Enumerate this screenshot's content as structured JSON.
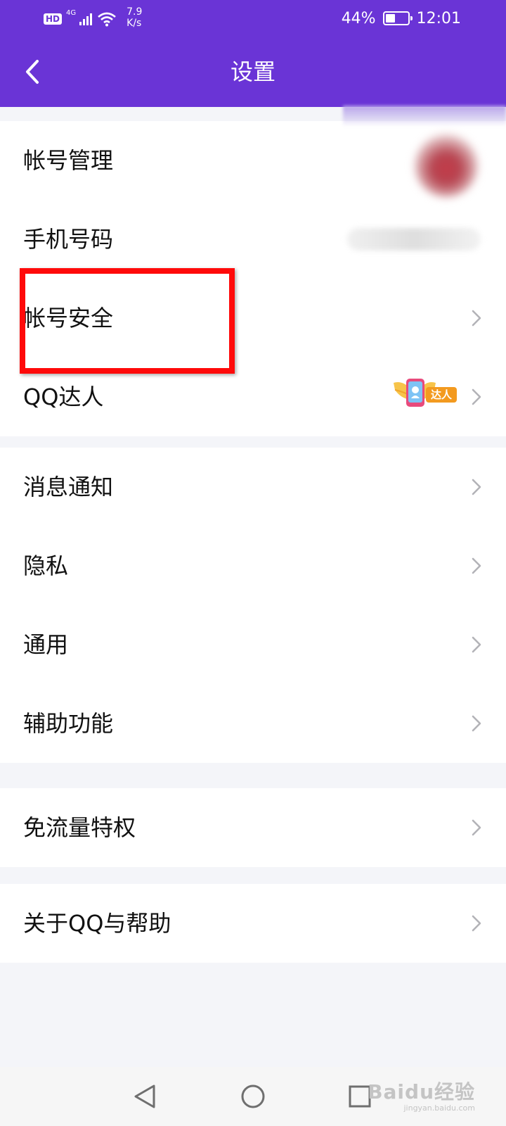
{
  "status_bar": {
    "hd": "HD",
    "network": "4G",
    "speed_value": "7.9",
    "speed_unit": "K/s",
    "battery_percent": "44%",
    "battery_level": 0.44,
    "time": "12:01"
  },
  "header": {
    "title": "设置",
    "back_icon": "chevron-left-icon",
    "background_color": "#6a34d6"
  },
  "groups": {
    "account": [
      {
        "label": "帐号管理"
      },
      {
        "label": "手机号码"
      },
      {
        "label": "帐号安全"
      },
      {
        "label": "QQ达人",
        "badge": "达人"
      }
    ],
    "settings": [
      {
        "label": "消息通知"
      },
      {
        "label": "隐私"
      },
      {
        "label": "通用"
      },
      {
        "label": "辅助功能"
      }
    ],
    "data": [
      {
        "label": "免流量特权"
      }
    ],
    "about": [
      {
        "label": "关于QQ与帮助"
      }
    ]
  },
  "annotation": {
    "highlight_color": "#ff0a0a",
    "highlighted_item": "帐号安全"
  },
  "nav_bar": {
    "back_icon": "triangle-back-icon",
    "home_icon": "circle-home-icon",
    "recents_icon": "square-recents-icon"
  },
  "watermark": {
    "brand": "Baidu经验",
    "url": "jingyan.baidu.com"
  }
}
